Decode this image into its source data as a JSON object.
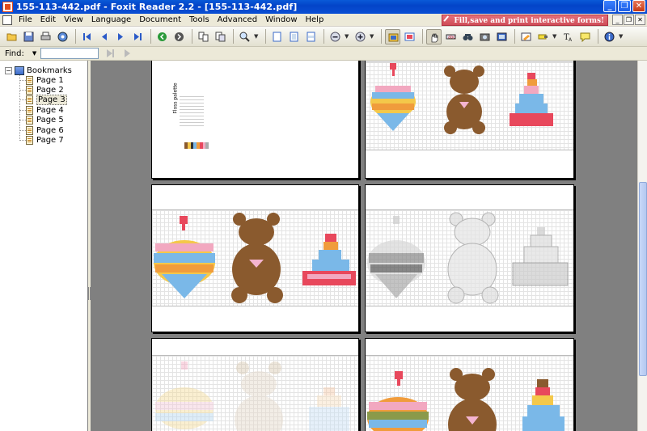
{
  "window": {
    "title": "155-113-442.pdf - Foxit Reader 2.2 - [155-113-442.pdf]",
    "buttons": [
      "_",
      "❐",
      "✕"
    ]
  },
  "menu": {
    "items": [
      "File",
      "Edit",
      "View",
      "Language",
      "Document",
      "Tools",
      "Advanced",
      "Window",
      "Help"
    ],
    "promo": "Fill,save and print interactive forms!"
  },
  "toolbar": {
    "icons": [
      "open-icon",
      "save-icon",
      "print-icon",
      "email-icon",
      "first-page-icon",
      "prev-page-icon",
      "next-page-icon",
      "last-page-icon",
      "go-back-icon",
      "go-forward-icon",
      "rotate-icon",
      "copy-icon",
      "zoom-in-icon",
      "actual-size-icon",
      "fit-page-icon",
      "fit-width-icon",
      "zoom-out-icon",
      "zoom-plus-icon",
      "single-page-icon",
      "continuous-icon",
      "hand-tool-icon",
      "select-text-icon",
      "find-icon",
      "snapshot-icon",
      "image-icon",
      "form-icon",
      "highlight-icon",
      "typewriter-icon",
      "note-icon",
      "about-icon"
    ]
  },
  "find": {
    "label": "Find:",
    "value": ""
  },
  "bookmarks": {
    "root": "Bookmarks",
    "items": [
      "Page 1",
      "Page 2",
      "Page 3",
      "Page 4",
      "Page 5",
      "Page 6",
      "Page 7"
    ],
    "selected": "Page 3"
  },
  "document": {
    "palette_title": "Floss palette",
    "colors": {
      "pink": "#f2a8c0",
      "blue": "#7ab8e8",
      "yellow": "#f4c84a",
      "orange": "#f09c3c",
      "brown": "#8a5a2e",
      "red": "#e8485c",
      "heart": "#f4b4d0",
      "gray": "#b8b8b8"
    }
  }
}
